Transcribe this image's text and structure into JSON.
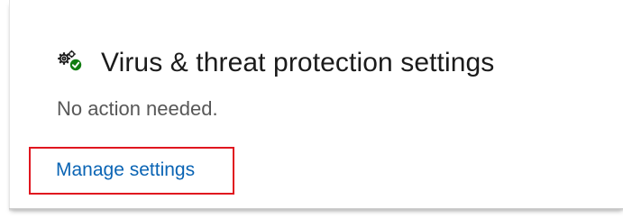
{
  "section": {
    "icon": "settings-gears-with-check-icon",
    "title": "Virus & threat protection settings",
    "status": "No action needed.",
    "link_label": "Manage settings"
  },
  "colors": {
    "title": "#1b1b1b",
    "status": "#575757",
    "link": "#0a64b4",
    "check_badge": "#107c10",
    "highlight_border": "#e0161f"
  }
}
